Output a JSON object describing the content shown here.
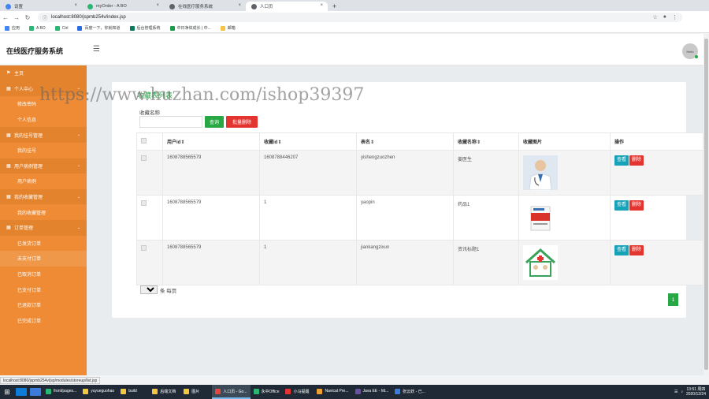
{
  "browser": {
    "tabs": [
      {
        "title": "设置",
        "color": "#4285f4",
        "active": false
      },
      {
        "title": "myOrder - A BO",
        "color": "#2bb673",
        "active": false
      },
      {
        "title": "在线医疗服务系统",
        "color": "#5f6368",
        "active": false
      },
      {
        "title": "人口页",
        "color": "#5f6368",
        "active": true
      }
    ],
    "new_tab": "+",
    "url": "localhost:8080/jspmb254v/index.jsp",
    "bookmarks": [
      "应用",
      "A BO",
      "Ctrl",
      "百度一下，你就知道",
      "后台管理系统",
      "中日净体成长 | 中...",
      "邮箱"
    ]
  },
  "app": {
    "title": "在线医疗服务系统",
    "avatar_text": "Hello"
  },
  "sidebar": {
    "items": [
      {
        "label": "主页",
        "type": "group",
        "icon": "flag-icon"
      },
      {
        "label": "个人中心",
        "type": "group",
        "icon": "grid-icon"
      },
      {
        "label": "修改密码",
        "type": "sub"
      },
      {
        "label": "个人信息",
        "type": "sub"
      },
      {
        "label": "我的挂号管理",
        "type": "group",
        "icon": "grid-icon"
      },
      {
        "label": "我的挂号",
        "type": "sub"
      },
      {
        "label": "用户病例管理",
        "type": "group",
        "icon": "grid-icon"
      },
      {
        "label": "用户病例",
        "type": "sub"
      },
      {
        "label": "我的收藏管理",
        "type": "group",
        "icon": "grid-icon"
      },
      {
        "label": "我的收藏管理",
        "type": "sub"
      },
      {
        "label": "订单管理",
        "type": "group",
        "icon": "grid-icon"
      },
      {
        "label": "已发货订单",
        "type": "sub"
      },
      {
        "label": "未支付订单",
        "type": "sub"
      },
      {
        "label": "已取消订单",
        "type": "sub"
      },
      {
        "label": "已支付订单",
        "type": "sub"
      },
      {
        "label": "已退款订单",
        "type": "sub"
      },
      {
        "label": "已完成订单",
        "type": "sub"
      }
    ]
  },
  "main": {
    "title": "收藏表列表",
    "filter_label": "收藏名称",
    "filter_placeholder": "",
    "search_btn": "查询",
    "batch_delete_btn": "批量删除",
    "columns": [
      "用户id⇕",
      "收藏id⇕",
      "表名⇕",
      "收藏名称⇕",
      "收藏图片",
      "操作"
    ],
    "rows": [
      {
        "userid": "1608788565579",
        "refid": "1608788446207",
        "table": "yishengzuozhen",
        "name": "姜医生",
        "img": "doctor"
      },
      {
        "userid": "1608788565579",
        "refid": "1",
        "table": "yaopin",
        "name": "药品1",
        "img": "medicine"
      },
      {
        "userid": "1608788565579",
        "refid": "1",
        "table": "jiankangzixun",
        "name": "资讯标题1",
        "img": "health"
      }
    ],
    "view_btn": "查看",
    "delete_btn": "删除",
    "page_size": "10",
    "page_size_suffix": "条 每页",
    "current_page": "1"
  },
  "status_url": "localhost:8080/jspmb254v/jsp/modules/storeup/list.jsp",
  "watermark": "https://www.huzhan.com/ishop39397",
  "taskbar": {
    "apps": [
      "front/pages...",
      "yuyueguohao",
      "build",
      "后端文档",
      "图片",
      "人口页 - Go...",
      "永中Office",
      "小马提醒",
      "Navicat Pre...",
      "Java EE - htt...",
      "张云妖 - 已..."
    ],
    "time": "13:51 周四",
    "date": "2020/12/24"
  },
  "colors": {
    "sidebar": "#ee8b34",
    "accent_green": "#28a745",
    "danger": "#e3342f",
    "info": "#17a2b8"
  }
}
